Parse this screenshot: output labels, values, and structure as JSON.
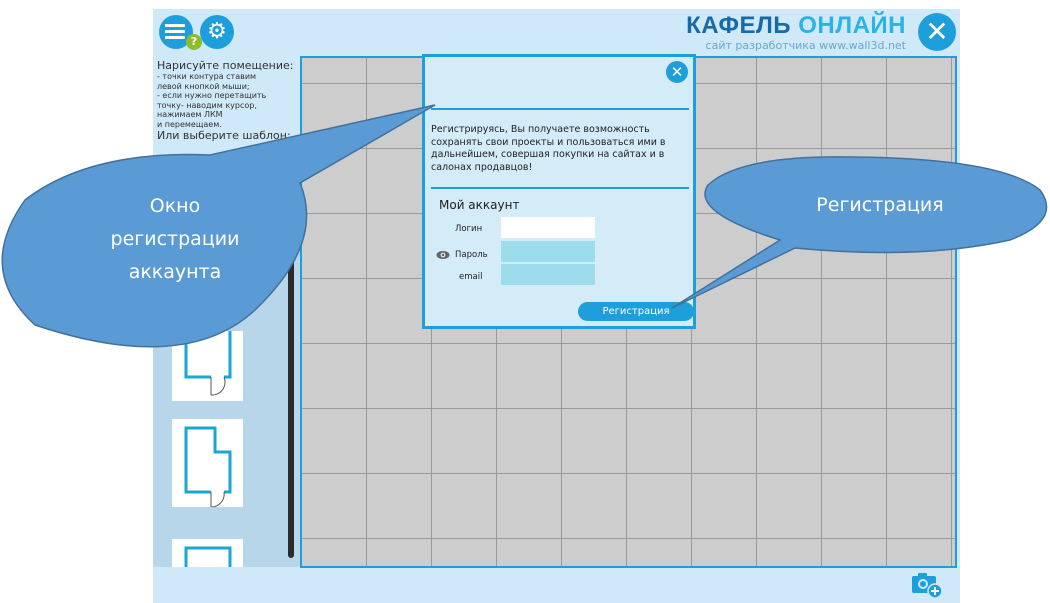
{
  "colors": {
    "accent": "#1e9fdc",
    "app_background": "#cfe9f8",
    "callout_fill": "#5b9bd5",
    "callout_stroke": "#41719c",
    "grid_background": "#cdcdcd"
  },
  "header": {
    "menu_icon": "list-icon",
    "help_icon": "question-icon",
    "settings_icon": "gear-icon",
    "logo_word1": "КАФЕЛЬ",
    "logo_word2": "ОНЛАЙН",
    "logo_subtitle": "сайт разработчика www.wall3d.net",
    "close_icon": "close-icon"
  },
  "sidebar": {
    "heading": "Нарисуйте помещение:",
    "instructions": [
      "- точки контура ставим",
      "левой кнопкой мыши;",
      "- если нужно перетащить",
      "точку- наводим курсор,",
      "нажимаем ЛКМ",
      "и перемещаем."
    ],
    "template_prompt": "Или выберите шаблон:"
  },
  "modal": {
    "close_icon": "close-icon",
    "message": "Регистрируясь,   Вы получаете возможность сохранять  свои проекты и пользоваться  ими в дальнейшем, совершая покупки на сайтах и в салонах продавцов!",
    "section_title": "Мой аккаунт",
    "login_label": "Логин",
    "password_label": "Пароль",
    "email_label": "email",
    "login_value": "",
    "password_value": "",
    "email_value": "",
    "register_button": "Регистрация"
  },
  "footer": {
    "camera_icon": "camera-add-icon"
  },
  "callouts": {
    "left": "Окно регистрации аккаунта",
    "right": "Регистрация"
  }
}
